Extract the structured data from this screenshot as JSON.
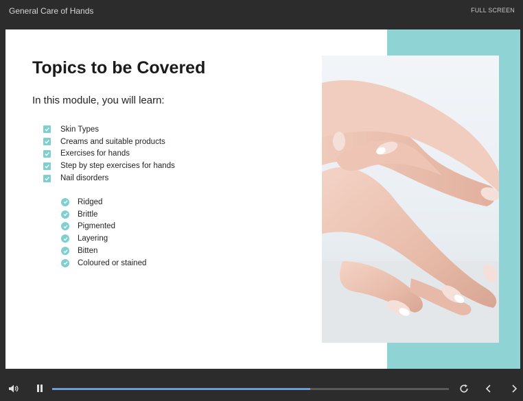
{
  "header": {
    "title": "General Care of Hands",
    "fullscreen_label": "FULL SCREEN"
  },
  "slide": {
    "title": "Topics to be Covered",
    "intro": "In this module, you will learn:",
    "topics": [
      "Skin Types",
      "Creams and suitable products",
      "Exercises for hands",
      "Step by step exercises for hands",
      "Nail disorders"
    ],
    "nail_disorders": [
      "Ridged",
      "Brittle",
      "Pigmented",
      "Layering",
      "Bitten",
      "Coloured or stained"
    ],
    "accent_color": "#8fd3d5",
    "image": "hands-manicure-photo"
  },
  "player": {
    "progress": 0.65,
    "icons": [
      "volume-icon",
      "pause-icon",
      "replay-icon",
      "previous-icon",
      "next-icon"
    ]
  }
}
